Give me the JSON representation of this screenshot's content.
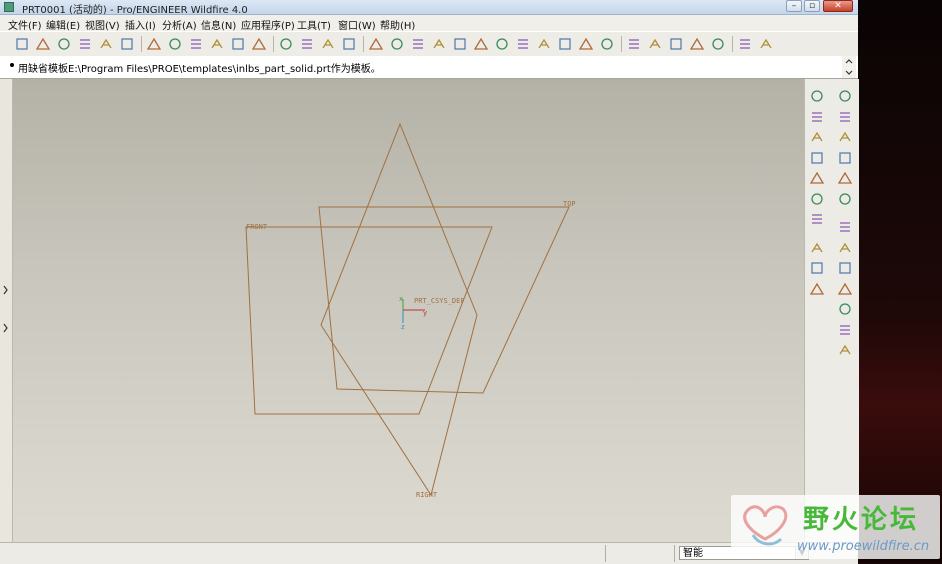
{
  "window": {
    "title": "PRT0001 (活动的) - Pro/ENGINEER Wildfire 4.0",
    "minimize": "–",
    "maximize": "▫",
    "close": "✕"
  },
  "menu": [
    "文件(F)",
    "编辑(E)",
    "视图(V)",
    "插入(I)",
    "分析(A)",
    "信息(N)",
    "应用程序(P)",
    "工具(T)",
    "窗口(W)",
    "帮助(H)"
  ],
  "toolbar_icons": [
    "new-icon",
    "open-icon",
    "save-icon",
    "print-icon",
    "send-icon",
    "close-window-icon",
    "undo-icon",
    "redo-icon",
    "cut-icon",
    "copy-icon",
    "paste-icon",
    "paste-special-icon",
    "regenerate-icon",
    "find-icon",
    "select-box-icon",
    "repaint-icon",
    "spin-center-icon",
    "orient-icon",
    "zoom-in-icon",
    "zoom-out-icon",
    "refit-icon",
    "reorient-icon",
    "saved-views-icon",
    "layers-icon",
    "view-manager-icon",
    "wireframe-icon",
    "hidden-line-icon",
    "no-hidden-icon",
    "shading-icon",
    "datum-planes-icon",
    "datum-axes-icon",
    "datum-points-icon",
    "coord-sys-icon",
    "annotation-icon",
    "context-help-icon"
  ],
  "message": {
    "text": "用缺省模板E:\\Program Files\\PROE\\templates\\inlbs_part_solid.prt作为模板。"
  },
  "viewport": {
    "datum_labels": {
      "front": "FRONT",
      "top": "TOP",
      "right": "RIGHT",
      "csys": "PRT_CSYS_DEF"
    },
    "datum_color": "#a07040"
  },
  "right_toolbar_icons": [
    "sketch-datum-icon",
    "plane-icon",
    "axis-icon",
    "curve-icon",
    "point-icon",
    "csys-icon",
    "analysis-feature-icon",
    "sketch-tool-icon",
    "extrude-icon",
    "revolve-icon",
    "variable-section-sweep-icon",
    "boundary-blend-icon",
    "style-icon",
    "mirror-icon",
    "merge-icon",
    "trim-icon",
    "pattern-icon",
    "hole-icon",
    "shell-icon",
    "rib-icon",
    "draft-icon",
    "round-icon",
    "chamfer-icon"
  ],
  "status": {
    "filter_value": "智能"
  },
  "watermark": {
    "title": "野火论坛",
    "url": "www.proewildfire.cn"
  }
}
